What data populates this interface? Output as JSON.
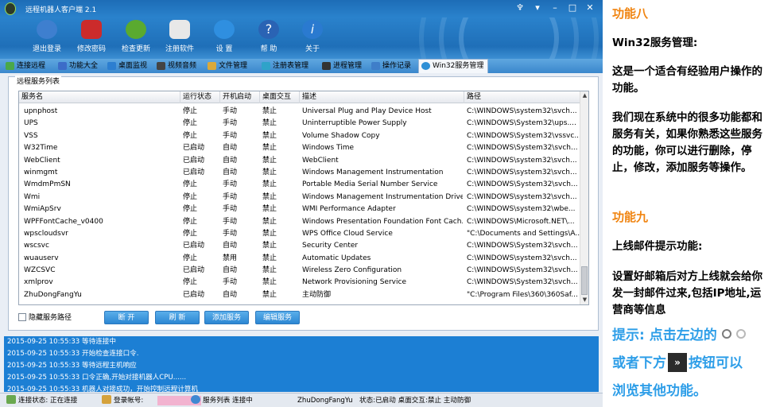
{
  "window": {
    "title": "远程机器人客户端 2.1"
  },
  "toolbar": {
    "buttons": [
      {
        "label": "退出登录",
        "icon": "logout-users-icon",
        "color": "#3e7fcf"
      },
      {
        "label": "修改密码",
        "icon": "password-icon",
        "color": "#cc2b2b"
      },
      {
        "label": "检查更新",
        "icon": "update-globe-icon",
        "color": "#5aaa2f"
      },
      {
        "label": "注册软件",
        "icon": "register-icon",
        "color": "#e8e8e8"
      },
      {
        "label": "设 置",
        "icon": "settings-gear-icon",
        "color": "#2f8fe0"
      },
      {
        "label": "帮 助",
        "icon": "help-icon",
        "color": "#2a63b4"
      },
      {
        "label": "关于",
        "icon": "about-info-icon",
        "color": "#2a7ad0"
      }
    ]
  },
  "tabs": [
    {
      "label": "连接远程",
      "icon": "connect-icon",
      "color": "#4aa84a"
    },
    {
      "label": "功能大全",
      "icon": "wand-icon",
      "color": "#3c6cc8"
    },
    {
      "label": "桌面监视",
      "icon": "desktop-icon",
      "color": "#2c7ed0"
    },
    {
      "label": "视频音频",
      "icon": "video-icon",
      "color": "#444444"
    },
    {
      "label": "文件管理",
      "icon": "file-icon",
      "color": "#d9a93a"
    },
    {
      "label": "注册表管理",
      "icon": "registry-icon",
      "color": "#2fa3c9"
    },
    {
      "label": "进程管理",
      "icon": "process-icon",
      "color": "#333333"
    },
    {
      "label": "操作记录",
      "icon": "record-icon",
      "color": "#3f7ec9"
    },
    {
      "label": "Win32服务管理",
      "icon": "service-icon",
      "color": "#2d8fd6",
      "active": true
    }
  ],
  "services": {
    "group_title": "远程服务列表",
    "columns": [
      "服务名",
      "运行状态",
      "开机启动",
      "桌面交互",
      "描述",
      "路径"
    ],
    "rows": [
      {
        "name": "upnphost",
        "state": "停止",
        "startup": "手动",
        "interact": "禁止",
        "desc": "Universal Plug and Play Device Host",
        "path": "C:\\WINDOWS\\system32\\svch..."
      },
      {
        "name": "UPS",
        "state": "停止",
        "startup": "手动",
        "interact": "禁止",
        "desc": "Uninterruptible Power Supply",
        "path": "C:\\WINDOWS\\System32\\ups...."
      },
      {
        "name": "VSS",
        "state": "停止",
        "startup": "手动",
        "interact": "禁止",
        "desc": "Volume Shadow Copy",
        "path": "C:\\WINDOWS\\System32\\vssvc..."
      },
      {
        "name": "W32Time",
        "state": "已启动",
        "startup": "自动",
        "interact": "禁止",
        "desc": "Windows Time",
        "path": "C:\\WINDOWS\\System32\\svch..."
      },
      {
        "name": "WebClient",
        "state": "已启动",
        "startup": "自动",
        "interact": "禁止",
        "desc": "WebClient",
        "path": "C:\\WINDOWS\\system32\\svch..."
      },
      {
        "name": "winmgmt",
        "state": "已启动",
        "startup": "自动",
        "interact": "禁止",
        "desc": "Windows Management Instrumentation",
        "path": "C:\\WINDOWS\\system32\\svch..."
      },
      {
        "name": "WmdmPmSN",
        "state": "停止",
        "startup": "手动",
        "interact": "禁止",
        "desc": "Portable Media Serial Number Service",
        "path": "C:\\WINDOWS\\System32\\svch..."
      },
      {
        "name": "Wmi",
        "state": "停止",
        "startup": "手动",
        "interact": "禁止",
        "desc": "Windows Management Instrumentation Drive...",
        "path": "C:\\WINDOWS\\system32\\svch..."
      },
      {
        "name": "WmiApSrv",
        "state": "停止",
        "startup": "手动",
        "interact": "禁止",
        "desc": "WMI Performance Adapter",
        "path": "C:\\WINDOWS\\system32\\wbe..."
      },
      {
        "name": "WPFFontCache_v0400",
        "state": "停止",
        "startup": "手动",
        "interact": "禁止",
        "desc": "Windows Presentation Foundation Font Cach...",
        "path": "C:\\WINDOWS\\Microsoft.NET\\..."
      },
      {
        "name": "wpscloudsvr",
        "state": "停止",
        "startup": "手动",
        "interact": "禁止",
        "desc": "WPS Office Cloud Service",
        "path": "\"C:\\Documents and Settings\\A..."
      },
      {
        "name": "wscsvc",
        "state": "已启动",
        "startup": "自动",
        "interact": "禁止",
        "desc": "Security Center",
        "path": "C:\\WINDOWS\\System32\\svch..."
      },
      {
        "name": "wuauserv",
        "state": "停止",
        "startup": "禁用",
        "interact": "禁止",
        "desc": "Automatic Updates",
        "path": "C:\\WINDOWS\\system32\\svch..."
      },
      {
        "name": "WZCSVC",
        "state": "已启动",
        "startup": "自动",
        "interact": "禁止",
        "desc": "Wireless Zero Configuration",
        "path": "C:\\WINDOWS\\System32\\svch..."
      },
      {
        "name": "xmlprov",
        "state": "停止",
        "startup": "手动",
        "interact": "禁止",
        "desc": "Network Provisioning Service",
        "path": "C:\\WINDOWS\\System32\\svch..."
      },
      {
        "name": "ZhuDongFangYu",
        "state": "已启动",
        "startup": "自动",
        "interact": "禁止",
        "desc": "主动防御",
        "path": "\"C:\\Program Files\\360\\360Saf..."
      }
    ],
    "hide_path_label": "隐藏服务路径",
    "buttons": [
      "断 开",
      "刷 新",
      "添加服务",
      "编辑服务"
    ]
  },
  "log": [
    "2015-09-25 10:55:33 等待连接中",
    "2015-09-25 10:55:33 开始检查连接口令.",
    "2015-09-25 10:55:33 等待远程主机响应",
    "2015-09-25 10:55:33 口令正确,开始对接机器人CPU......",
    "2015-09-25 10:55:33 机器人对接成功，开始控制远程计算机"
  ],
  "statusbar": {
    "connect_status": "连接状态: 正在连接",
    "login_account": "登录帐号:",
    "service_list": "服务列表 连接中",
    "service_name": "ZhuDongFangYu",
    "service_state": "状态:已启动 桌面交互:禁止 主动防御"
  },
  "panel": {
    "feature8_title": "功能八",
    "feature8_sub": "Win32服务管理:",
    "feature8_text1": "这是一个适合有经验用户操作的功能。",
    "feature8_text2": "我们现在系统中的很多功能都和服务有关，如果你熟悉这些服务的功能，你可以进行删除，停止，修改，添加服务等操作。",
    "feature9_title": "功能九",
    "feature9_sub": "上线邮件提示功能:",
    "feature9_text": "设置好邮箱后对方上线就会给你发一封邮件过来,包括IP地址,运营商等信息",
    "tip_line1": "提示: 点击左边的",
    "tip_line2a": "或者下方",
    "tip_next": "»",
    "tip_line2b": "按钮可以",
    "tip_line3": "浏览其他功能。"
  },
  "colors": {
    "accent_orange": "#f08410",
    "tip_blue": "#2e9ee8",
    "titlebar_blue": "#1d6cb6",
    "log_blue": "#1c7fd4"
  }
}
